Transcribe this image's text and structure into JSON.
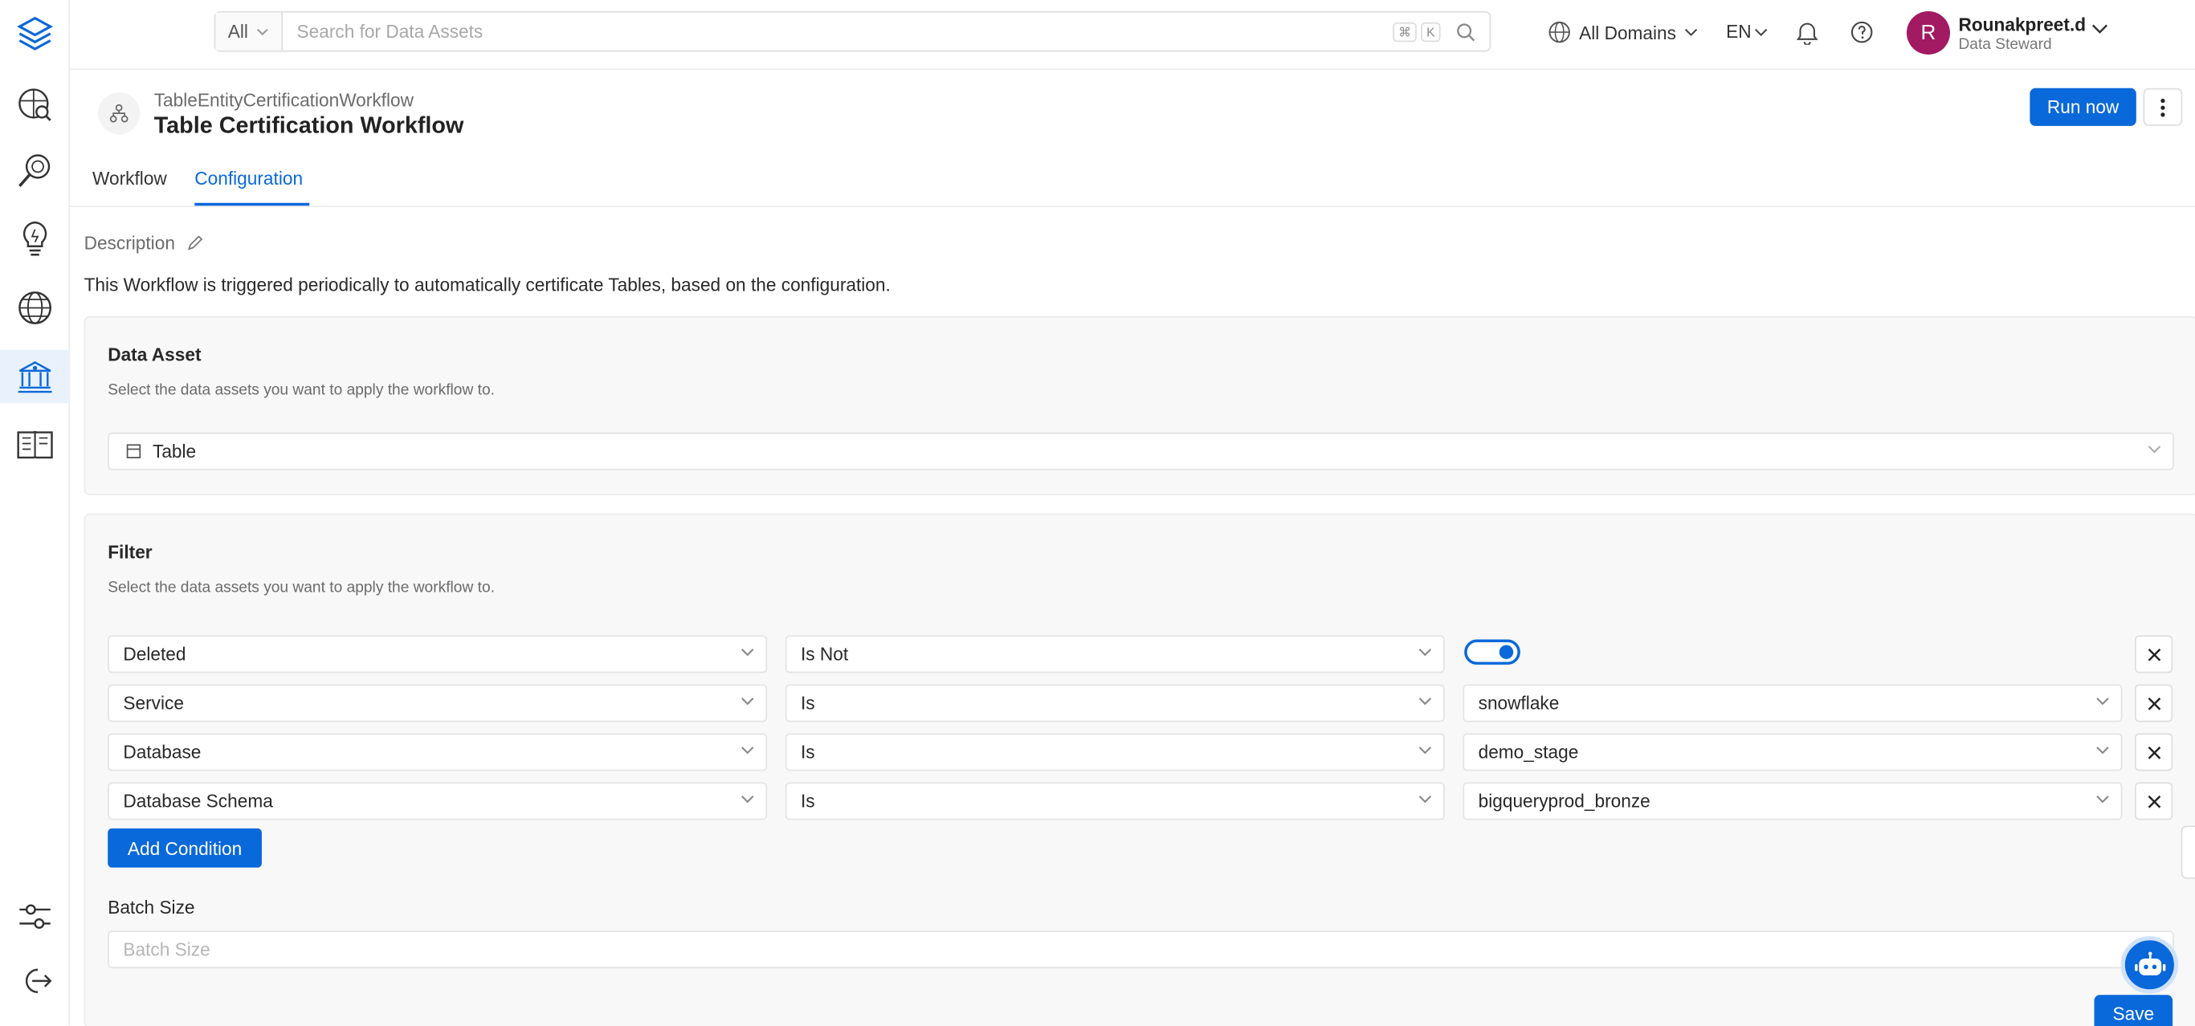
{
  "header": {
    "search_scope": "All",
    "search_placeholder": "Search for Data Assets",
    "shortcut_cmd": "⌘",
    "shortcut_key": "K",
    "domains_label": "All Domains",
    "language": "EN",
    "user_name": "Rounakpreet.d",
    "user_role": "Data Steward",
    "avatar_initial": "R",
    "avatar_color": "#a21a61"
  },
  "sidebar": {
    "items": [
      {
        "icon": "logo-icon"
      },
      {
        "icon": "explore-icon"
      },
      {
        "icon": "observability-icon"
      },
      {
        "icon": "insights-icon"
      },
      {
        "icon": "domains-icon"
      },
      {
        "icon": "governance-icon",
        "active": true
      },
      {
        "icon": "glossary-icon"
      },
      {
        "icon": "settings-icon"
      },
      {
        "icon": "logout-icon"
      }
    ]
  },
  "workflow": {
    "fqn": "TableEntityCertificationWorkflow",
    "title": "Table Certification Workflow",
    "run_now_label": "Run now"
  },
  "tabs": [
    {
      "label": "Workflow",
      "active": false
    },
    {
      "label": "Configuration",
      "active": true
    }
  ],
  "description": {
    "label": "Description",
    "text": "This Workflow is triggered periodically to automatically certificate Tables, based on the configuration."
  },
  "data_asset": {
    "title": "Data Asset",
    "subtitle": "Select the data assets you want to apply the workflow to.",
    "selected": "Table"
  },
  "filter": {
    "title": "Filter",
    "subtitle": "Select the data assets you want to apply the workflow to.",
    "conditions": [
      {
        "field": "Deleted",
        "operator": "Is Not",
        "value": "",
        "value_type": "toggle",
        "toggle_on": true
      },
      {
        "field": "Service",
        "operator": "Is",
        "value": "snowflake",
        "value_type": "select"
      },
      {
        "field": "Database",
        "operator": "Is",
        "value": "demo_stage",
        "value_type": "select"
      },
      {
        "field": "Database Schema",
        "operator": "Is",
        "value": "bigqueryprod_bronze",
        "value_type": "select"
      }
    ],
    "add_condition_label": "Add Condition",
    "batch_size_label": "Batch Size",
    "batch_size_placeholder": "Batch Size"
  },
  "save_label": "Save",
  "accent_color": "#0968da"
}
